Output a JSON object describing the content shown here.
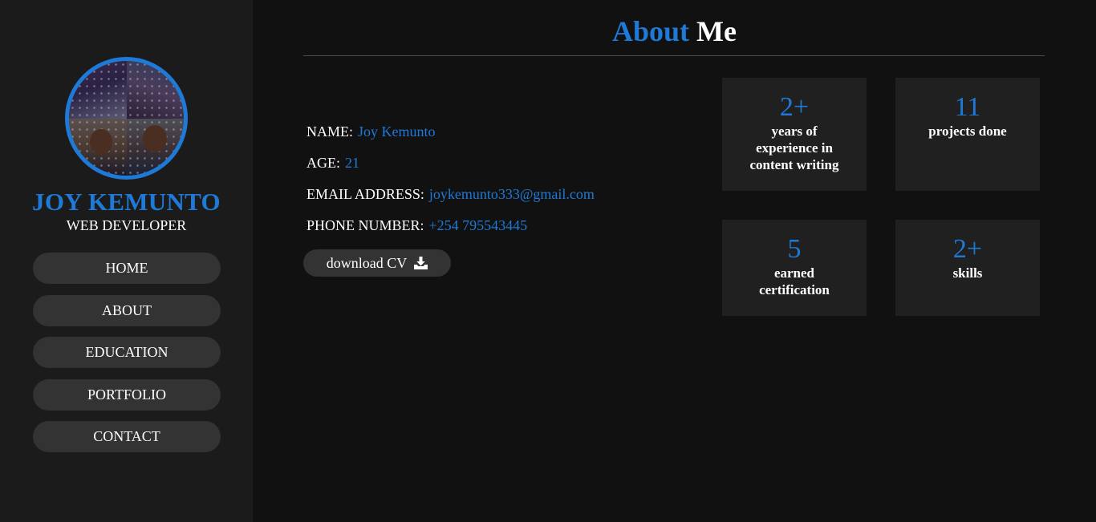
{
  "owner": {
    "name": "JOY KEMUNTO",
    "role": "WEB DEVELOPER"
  },
  "nav": [
    {
      "label": "HOME"
    },
    {
      "label": "ABOUT"
    },
    {
      "label": "EDUCATION"
    },
    {
      "label": "PORTFOLIO"
    },
    {
      "label": "CONTACT"
    }
  ],
  "title": {
    "accent": "About",
    "rest": "Me"
  },
  "info": [
    {
      "label": "NAME:",
      "value": "Joy Kemunto"
    },
    {
      "label": "AGE:",
      "value": "21"
    },
    {
      "label": "EMAIL ADDRESS:",
      "value": "joykemunto333@gmail.com"
    },
    {
      "label": "PHONE NUMBER:",
      "value": "+254 795543445"
    }
  ],
  "download": {
    "label": "download CV",
    "icon": "download-icon"
  },
  "stats": [
    {
      "number": "2+",
      "desc": "years of experience in content writing"
    },
    {
      "number": "11",
      "desc": "projects done"
    },
    {
      "number": "5",
      "desc": "earned certification"
    },
    {
      "number": "2+",
      "desc": "skills"
    }
  ],
  "colors": {
    "accent": "#1e7ad6",
    "background": "#111111",
    "sidebar": "#1b1b1b",
    "button": "#333333",
    "card": "#202020"
  }
}
